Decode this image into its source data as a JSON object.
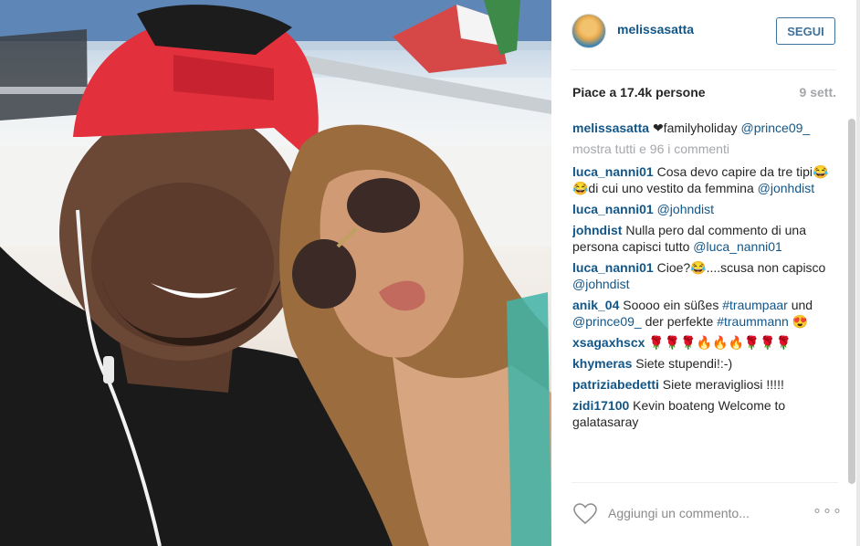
{
  "post": {
    "username": "melissasatta",
    "follow_label": "SEGUI",
    "likes": "Piace a 17.4k persone",
    "time_ago": "9 sett."
  },
  "caption": {
    "user": "melissasatta",
    "text": "❤familyholiday",
    "mention": "@prince09_"
  },
  "show_all": "mostra tutti e 96 i commenti",
  "comments": [
    {
      "user": "luca_nanni01",
      "text": "Cosa devo capire da tre tipi😂😂di cui uno vestito da femmina",
      "mention": "@jonhdist"
    },
    {
      "user": "luca_nanni01",
      "text": "",
      "mention": "@johndist"
    },
    {
      "user": "johndist",
      "text": "Nulla pero dal commento di una persona capisci tutto",
      "mention": "@luca_nanni01"
    },
    {
      "user": "luca_nanni01",
      "text": "Cioe?😂....scusa non capisco",
      "mention": "@johndist"
    },
    {
      "user": "anik_04",
      "text": "Soooo ein süßes",
      "tag": "#traumpaar",
      "text2": "und",
      "mention": "@prince09_",
      "text3": "der perfekte",
      "tag2": "#traummann",
      "emoji": "😍"
    },
    {
      "user": "xsagaxhscx",
      "text": "🌹🌹🌹🔥🔥🔥🌹🌹🌹"
    },
    {
      "user": "khymeras",
      "text": "Siete stupendi!:-)"
    },
    {
      "user": "patriziabedetti",
      "text": "Siete meravigliosi !!!!!"
    },
    {
      "user": "zidi17100",
      "text": "Kevin boateng Welcome to galatasaray"
    }
  ],
  "comment_box": {
    "placeholder": "Aggiungi un commento..."
  },
  "icons": {
    "heart": "heart-outline-icon",
    "more": "more-options-icon"
  },
  "colors": {
    "link": "#125688",
    "follow": "#3f729b",
    "muted": "#a5a7aa"
  }
}
